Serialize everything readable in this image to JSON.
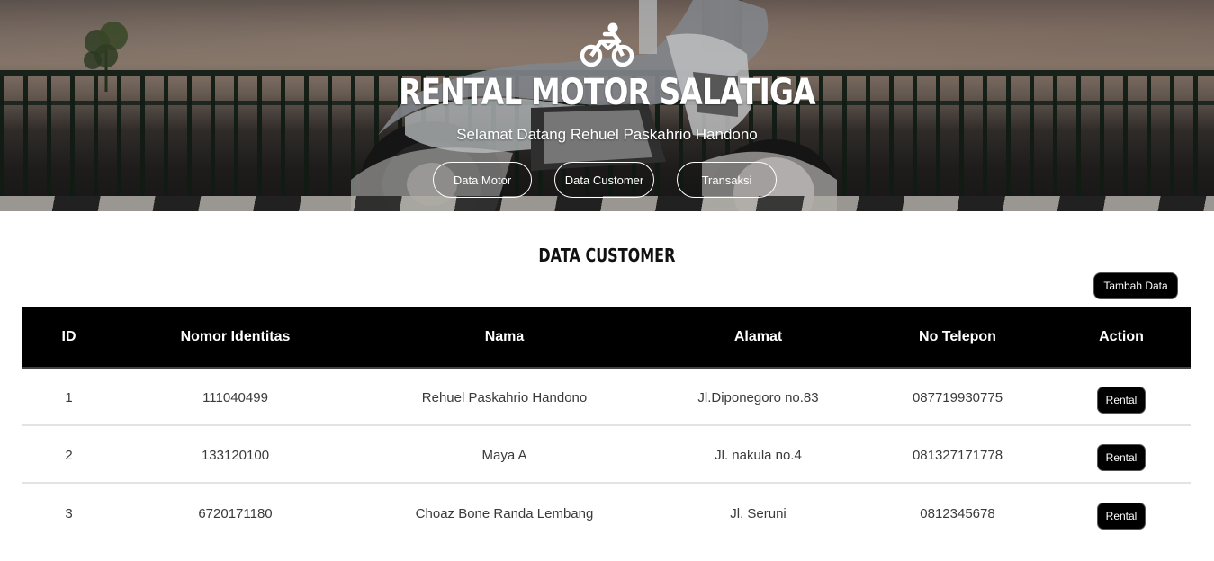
{
  "header": {
    "title": "RENTAL MOTOR SALATIGA",
    "welcome": "Selamat Datang Rehuel Paskahrio Handono",
    "nav": [
      "Data Motor",
      "Data Customer",
      "Transaksi"
    ]
  },
  "main": {
    "section_title": "DATA CUSTOMER",
    "add_button": "Tambah Data",
    "table": {
      "columns": [
        "ID",
        "Nomor Identitas",
        "Nama",
        "Alamat",
        "No Telepon",
        "Action"
      ],
      "rows": [
        {
          "id": "1",
          "nomor": "111040499",
          "nama": "Rehuel Paskahrio Handono",
          "alamat": "Jl.Diponegoro no.83",
          "telp": "087719930775",
          "action": "Rental"
        },
        {
          "id": "2",
          "nomor": "133120100",
          "nama": "Maya A",
          "alamat": "Jl. nakula no.4",
          "telp": "081327171778",
          "action": "Rental"
        },
        {
          "id": "3",
          "nomor": "6720171180",
          "nama": "Choaz Bone Randa Lembang",
          "alamat": "Jl. Seruni",
          "telp": "0812345678",
          "action": "Rental"
        }
      ]
    }
  },
  "icons": {
    "brand": "motorcycle-rider-icon"
  },
  "colors": {
    "table_header_bg": "#000000",
    "button_bg": "#000000",
    "hero_text": "#ffffff"
  }
}
